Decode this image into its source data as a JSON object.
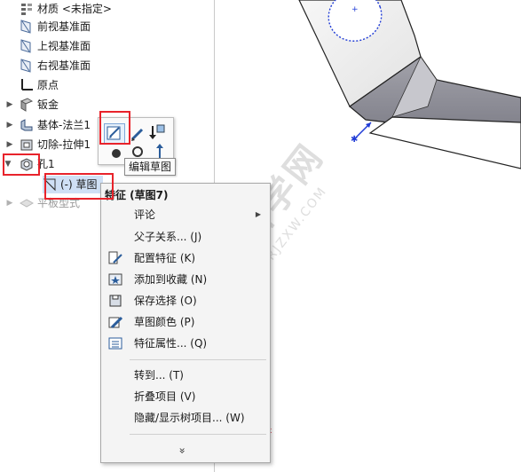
{
  "tree": {
    "items": [
      {
        "label": "材质 <未指定>",
        "icon": "material-icon"
      },
      {
        "label": "前视基准面",
        "icon": "plane-icon"
      },
      {
        "label": "上视基准面",
        "icon": "plane-icon"
      },
      {
        "label": "右视基准面",
        "icon": "plane-icon"
      },
      {
        "label": "原点",
        "icon": "origin-icon"
      },
      {
        "label": "钣金",
        "icon": "sheet-metal-icon"
      },
      {
        "label": "基体-法兰1",
        "icon": "base-flange-icon"
      },
      {
        "label": "切除-拉伸1",
        "icon": "cut-extrude-icon"
      },
      {
        "label": "孔1",
        "icon": "hole-icon"
      },
      {
        "label": "(-) 草图",
        "icon": "sketch-icon"
      },
      {
        "label": "平板型式",
        "icon": "flat-pattern-icon"
      }
    ]
  },
  "tooltip": "编辑草图",
  "menu": {
    "title": "特征 (草图7)",
    "items": [
      {
        "label": "评论",
        "icon": "",
        "submenu": true
      },
      {
        "label": "父子关系... (J)",
        "icon": ""
      },
      {
        "label": "配置特征 (K)",
        "icon": "configure-icon"
      },
      {
        "label": "添加到收藏 (N)",
        "icon": "favorite-icon"
      },
      {
        "label": "保存选择 (O)",
        "icon": "save-selection-icon"
      },
      {
        "label": "草图颜色 (P)",
        "icon": "sketch-color-icon"
      },
      {
        "label": "特征属性... (Q)",
        "icon": "feature-properties-icon"
      },
      {
        "label": "转到... (T)",
        "icon": ""
      },
      {
        "label": "折叠项目 (V)",
        "icon": ""
      },
      {
        "label": "隐藏/显示树项目... (W)",
        "icon": ""
      }
    ],
    "more": "»"
  },
  "watermark": {
    "main": "软件自学网",
    "sub": "WWW.RJZXW.COM"
  },
  "colors": {
    "highlight": "#e8232b",
    "model_gray": "#8e8e96",
    "selection_blue": "#1f3bd6"
  }
}
